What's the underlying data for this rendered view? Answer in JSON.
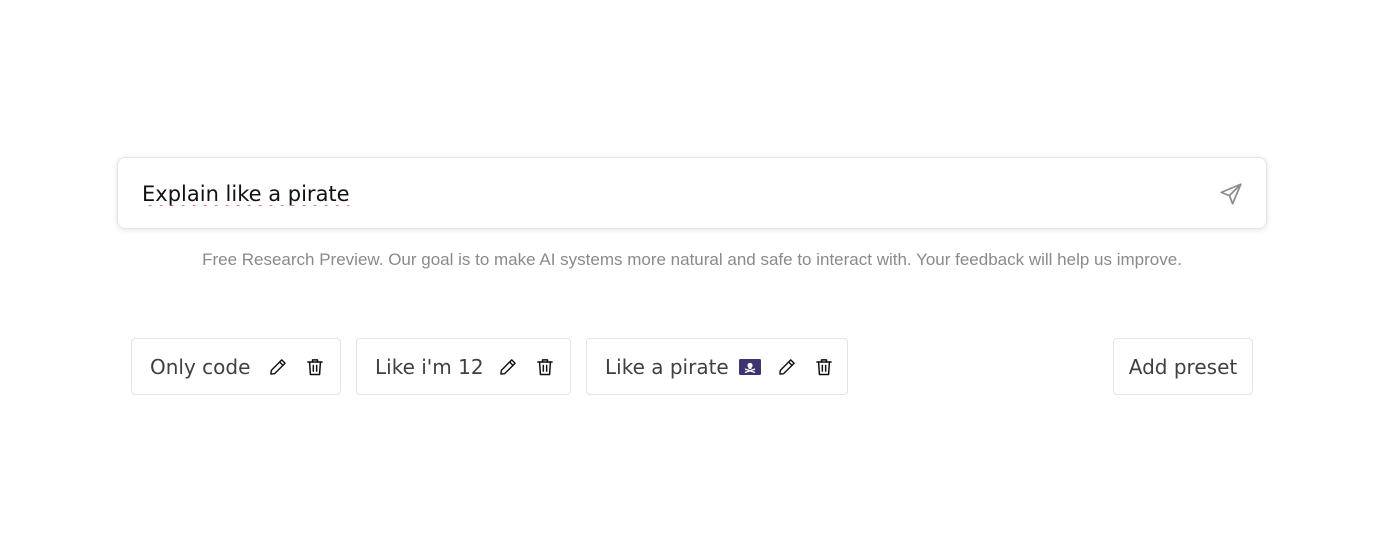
{
  "prompt": {
    "value": "Explain like a pirate",
    "send_icon": "send-icon"
  },
  "disclaimer": "Free Research Preview. Our goal is to make AI systems more natural and safe to interact with. Your feedback will help us improve.",
  "presets": [
    {
      "label": "Only code",
      "icons": [
        "edit-icon",
        "trash-icon"
      ]
    },
    {
      "label": "Like i'm 12",
      "icons": [
        "edit-icon",
        "trash-icon"
      ]
    },
    {
      "label": "Like a pirate",
      "emoji_icon": "pirate-flag-icon",
      "icons": [
        "edit-icon",
        "trash-icon"
      ]
    }
  ],
  "add_preset_label": "Add preset",
  "colors": {
    "border": "#e4e4e7",
    "text": "#3f3f46",
    "muted": "#8a8a8a",
    "spellcheck": "#e11d2a",
    "flag": "#3b3670"
  }
}
